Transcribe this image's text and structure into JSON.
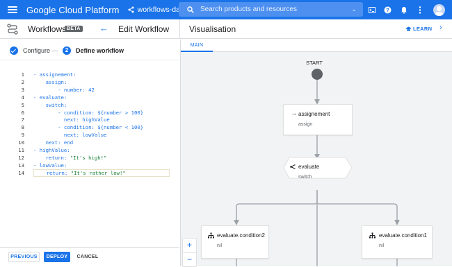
{
  "topbar": {
    "brand": "Google Cloud Platform",
    "project": "workflows-days",
    "search_placeholder": "Search products and resources",
    "icons": [
      "menu-icon",
      "project-icon",
      "search-icon",
      "terminal-icon",
      "help-icon",
      "notifications-icon",
      "more-vert-icon",
      "account-icon"
    ]
  },
  "header": {
    "product": "Workflows",
    "badge": "BETA",
    "page_title": "Edit Workflow",
    "panel_title": "Visualisation",
    "learn_label": "LEARN"
  },
  "stepper": {
    "step1_label": "Configure",
    "step2_number": "2",
    "step2_label": "Define workflow"
  },
  "editor": {
    "lines": [
      {
        "n": "1",
        "text": "- assignement:"
      },
      {
        "n": "2",
        "text": "    assign:"
      },
      {
        "n": "3",
        "text": "        - number: 42"
      },
      {
        "n": "4",
        "text": "- evaluate:"
      },
      {
        "n": "5",
        "text": "    switch:"
      },
      {
        "n": "6",
        "text": "        - condition: ${number > 100}"
      },
      {
        "n": "7",
        "text": "          next: highValue"
      },
      {
        "n": "8",
        "text": "        - condition: ${number < 100}"
      },
      {
        "n": "9",
        "text": "          next: lowValue"
      },
      {
        "n": "10",
        "text": "    next: end"
      },
      {
        "n": "11",
        "text": "- highValue:"
      },
      {
        "n": "12",
        "text": "    return: \"It's high!\""
      },
      {
        "n": "13",
        "text": "- lowValue:"
      },
      {
        "n": "14",
        "text": "    return: \"It's rather low!\""
      }
    ],
    "active_line": 14
  },
  "actions": {
    "previous": "PREVIOUS",
    "deploy": "DEPLOY",
    "cancel": "CANCEL"
  },
  "visualisation": {
    "tab": "MAIN",
    "start_label": "START",
    "nodes": [
      {
        "title": "assignement",
        "sub": "assign",
        "icon": "arrow-right-icon"
      },
      {
        "title": "evaluate",
        "sub": "switch",
        "icon": "switch-icon"
      },
      {
        "title": "evaluate.condition2",
        "sub": "nil",
        "icon": "condition-icon"
      },
      {
        "title": "evaluate.condition1",
        "sub": "nil",
        "icon": "condition-icon"
      }
    ],
    "zoom_in": "+",
    "zoom_out": "−"
  },
  "colors": {
    "accent": "#1a73e8",
    "canvas": "#f1f3f4",
    "code_keyword": "#1a73e8",
    "code_string": "#188038"
  }
}
